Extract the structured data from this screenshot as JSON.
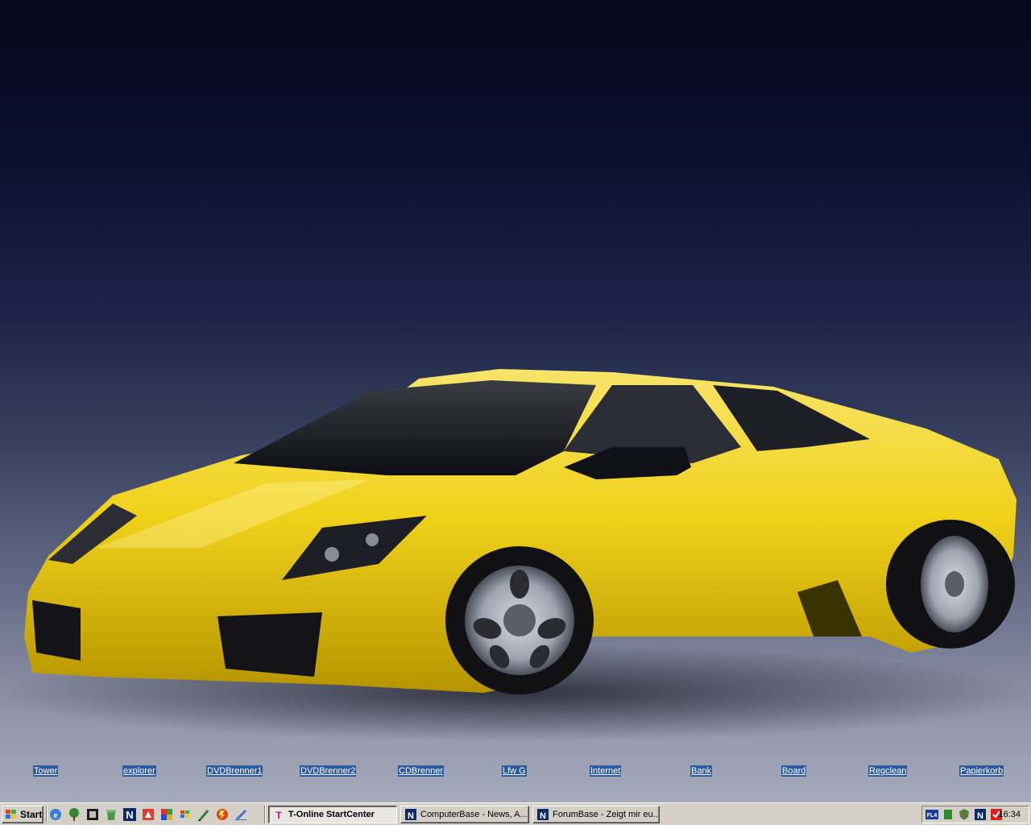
{
  "desktop": {
    "icons": [
      {
        "label": "Tower"
      },
      {
        "label": "explorer"
      },
      {
        "label": "DVDBrenner1"
      },
      {
        "label": "DVDBrenner2"
      },
      {
        "label": "CDBrenner"
      },
      {
        "label": "Lfw G"
      },
      {
        "label": "Internet"
      },
      {
        "label": "Bank"
      },
      {
        "label": "Board"
      },
      {
        "label": "Regclean"
      },
      {
        "label": "Papierkorb"
      }
    ]
  },
  "taskbar": {
    "start_label": "Start",
    "quick_launch": [
      "ie-icon",
      "tree-icon",
      "app-icon",
      "recycle-icon",
      "netscape-icon",
      "acrobat-icon",
      "media-icon",
      "windows-flag-icon",
      "pen-icon",
      "flash-icon",
      "edit-icon"
    ],
    "tasks": [
      {
        "label": "T-Online StartCenter",
        "active": true
      },
      {
        "label": "ComputerBase - News, A...",
        "active": false
      },
      {
        "label": "ForumBase - Zeigt mir eu...",
        "active": false
      }
    ],
    "tray_icons": [
      "flash-tray-icon",
      "network-tray-icon",
      "security-tray-icon",
      "netscape-tray-icon",
      "antivirus-tray-icon"
    ],
    "clock": "16:34"
  },
  "colors": {
    "taskbar": "#d4d0c8",
    "car": "#f2d81c",
    "icon_label_bg": "#2b5a9e"
  }
}
